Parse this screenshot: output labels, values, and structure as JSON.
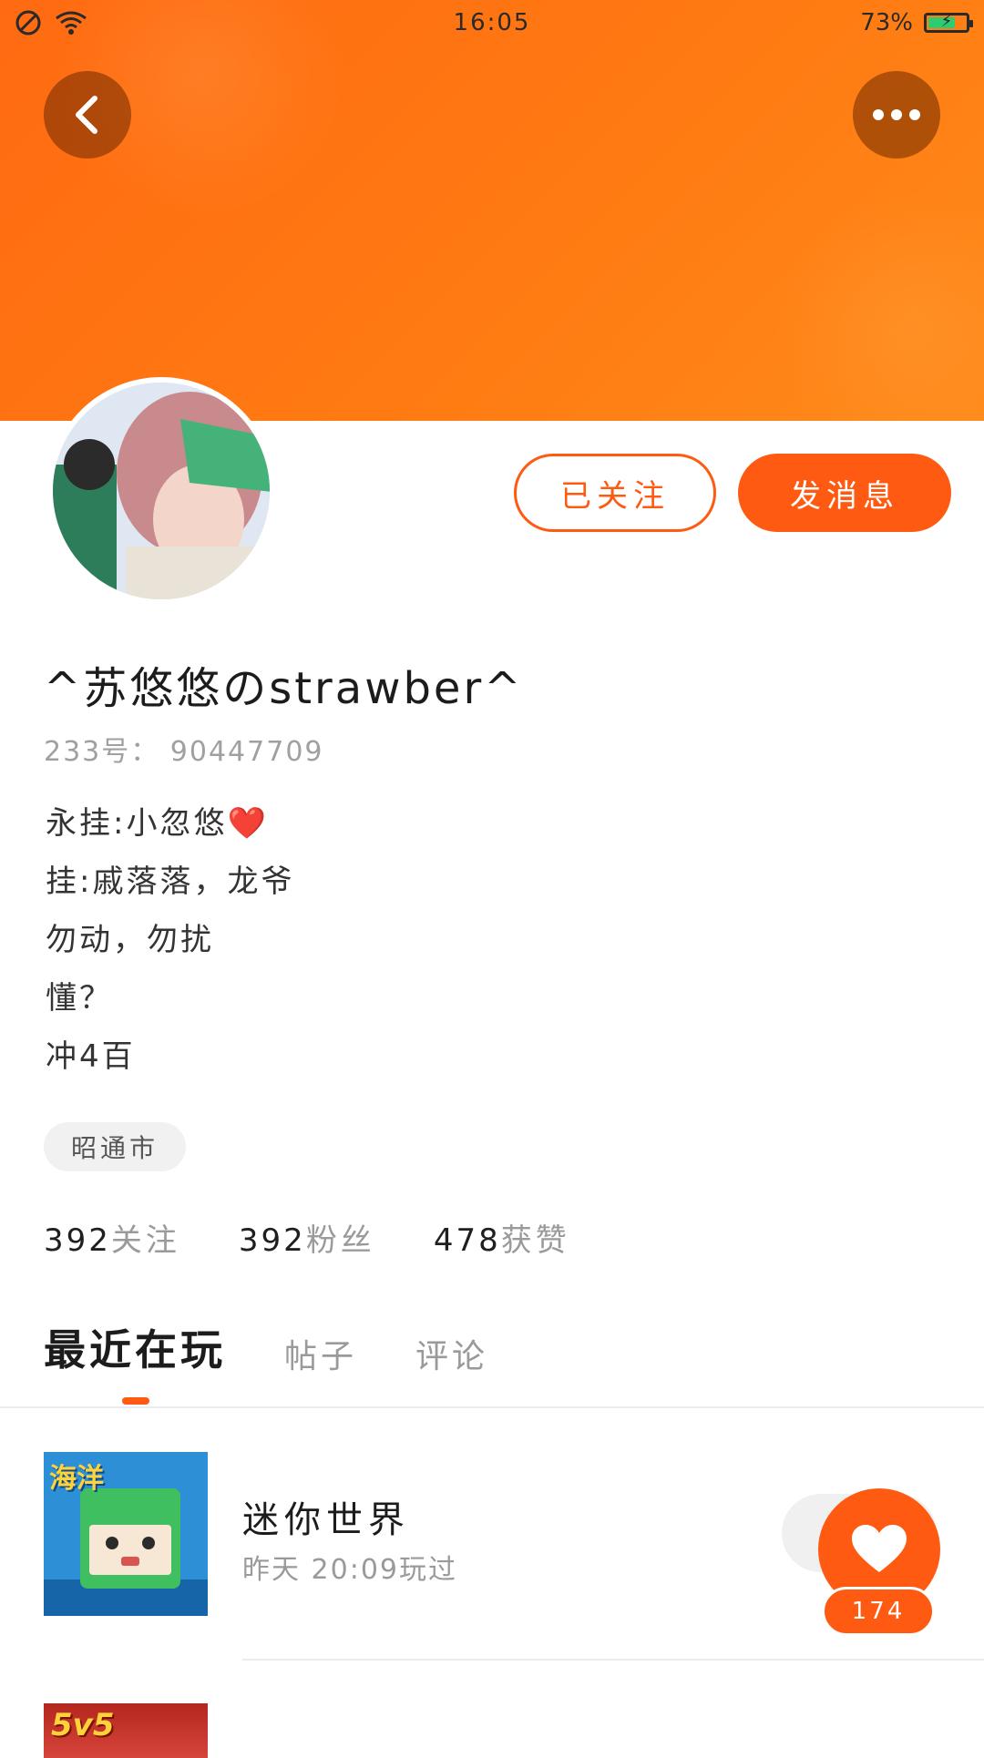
{
  "status_bar": {
    "time": "16:05",
    "battery": "73%",
    "battery_level": 0.73
  },
  "header": {
    "back_icon": "chevron-left-icon",
    "more_icon": "more-dots-icon"
  },
  "profile": {
    "follow_button": "已关注",
    "message_button": "发消息",
    "username": "^苏悠悠のstrawber^",
    "uid": "233号： 90447709",
    "bio": [
      "永挂:小忽悠❤️",
      "挂:戚落落，龙爷",
      "勿动，勿扰",
      "懂？",
      "冲4百"
    ],
    "location": "昭通市",
    "stats": [
      {
        "num": "392",
        "label": "关注"
      },
      {
        "num": "392",
        "label": "粉丝"
      },
      {
        "num": "478",
        "label": "获赞"
      }
    ]
  },
  "tabs": [
    "最近在玩",
    "帖子",
    "评论"
  ],
  "games": [
    {
      "name": "迷你世界",
      "last_played": "昨天 20:09玩过",
      "thumb_text": "海洋"
    },
    {
      "thumb_text": "5v5"
    }
  ],
  "like": {
    "count": "174"
  },
  "colors": {
    "accent": "#ff5a12",
    "header_start": "#ff6a12",
    "header_end": "#ff8a1a"
  }
}
